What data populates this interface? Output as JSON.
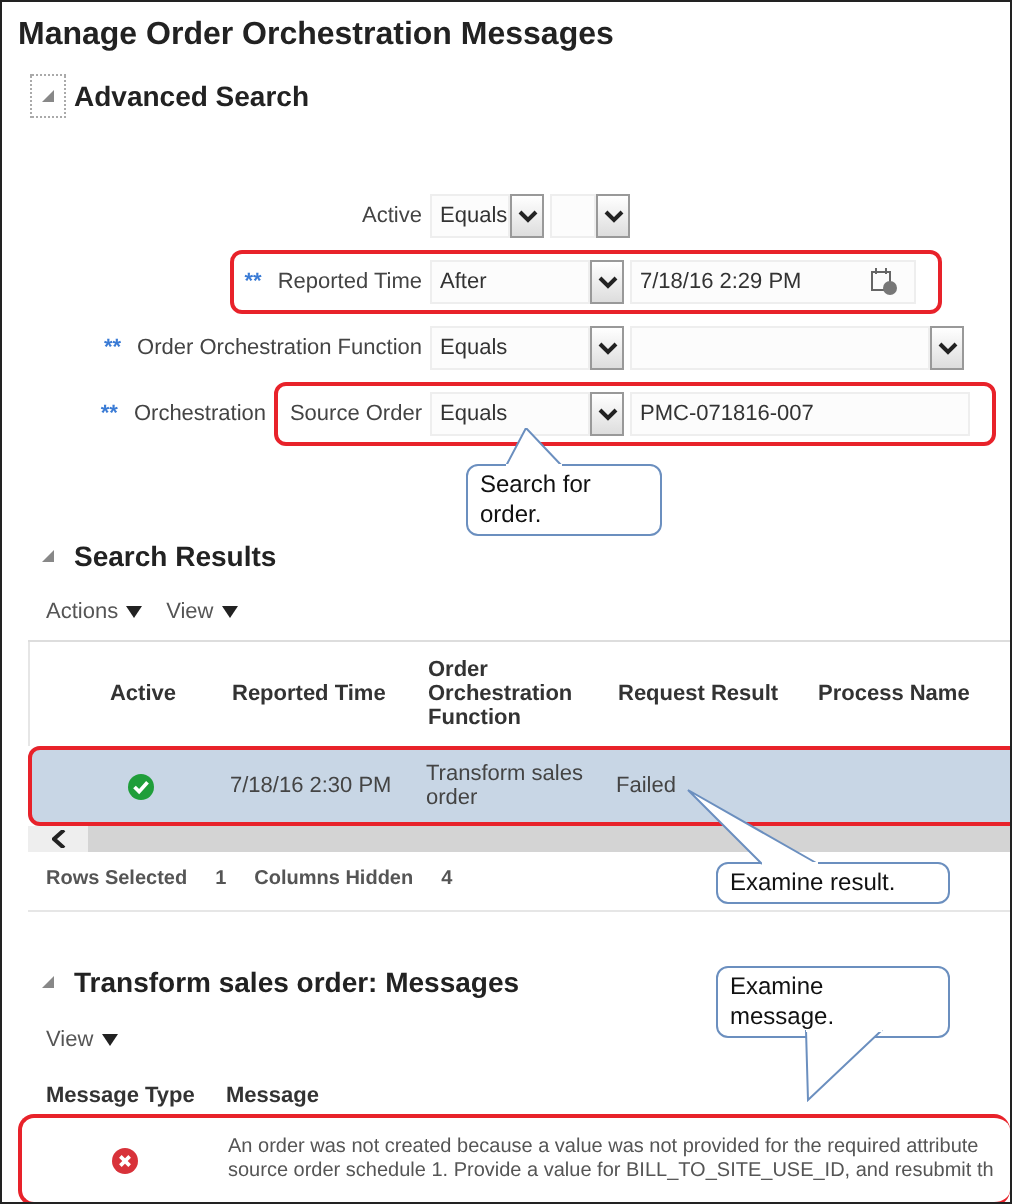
{
  "title": "Manage Order Orchestration Messages",
  "advanced_search": {
    "title": "Advanced Search",
    "expanded": true,
    "rows": [
      {
        "label": "Active",
        "operator": "Equals",
        "kind": "select",
        "value": "",
        "highlighted": false
      },
      {
        "label": "Reported Time",
        "required_mark": "**",
        "operator": "After",
        "kind": "date",
        "value": "7/18/16 2:29 PM",
        "highlighted": true
      },
      {
        "label": "Order Orchestration Function",
        "required_mark": "**",
        "operator": "Equals",
        "kind": "select",
        "value": "",
        "highlighted": false
      },
      {
        "label": "Orchestration",
        "inner_label": "Source Order",
        "required_mark": "**",
        "operator": "Equals",
        "kind": "text",
        "value": "PMC-071816-007",
        "highlighted": true
      }
    ]
  },
  "search_results": {
    "title": "Search Results",
    "expanded": true,
    "toolbar": [
      "Actions",
      "View"
    ],
    "columns": [
      "Active",
      "Reported Time",
      "Order Orchestration Function",
      "Request Result",
      "Process Name"
    ],
    "rows": [
      {
        "active": true,
        "reported_time": "7/18/16 2:30 PM",
        "function": "Transform sales order",
        "request_result": "Failed",
        "selected": true,
        "highlighted": true
      }
    ],
    "footer": [
      {
        "label": "Rows Selected",
        "value": "1"
      },
      {
        "label": "Columns Hidden",
        "value": "4"
      }
    ]
  },
  "messages": {
    "title": "Transform sales order: Messages",
    "expanded": true,
    "toolbar": [
      "View"
    ],
    "columns": [
      "Message Type",
      "Message"
    ],
    "rows": [
      {
        "kind": "error",
        "message_lines": [
          "An order was not created because a value was not provided for the required attribute",
          "source order schedule 1. Provide a value for BILL_TO_SITE_USE_ID, and resubmit th"
        ],
        "highlighted": true
      }
    ]
  },
  "callouts": [
    "Search for order.",
    "Examine result.",
    "Examine message."
  ]
}
